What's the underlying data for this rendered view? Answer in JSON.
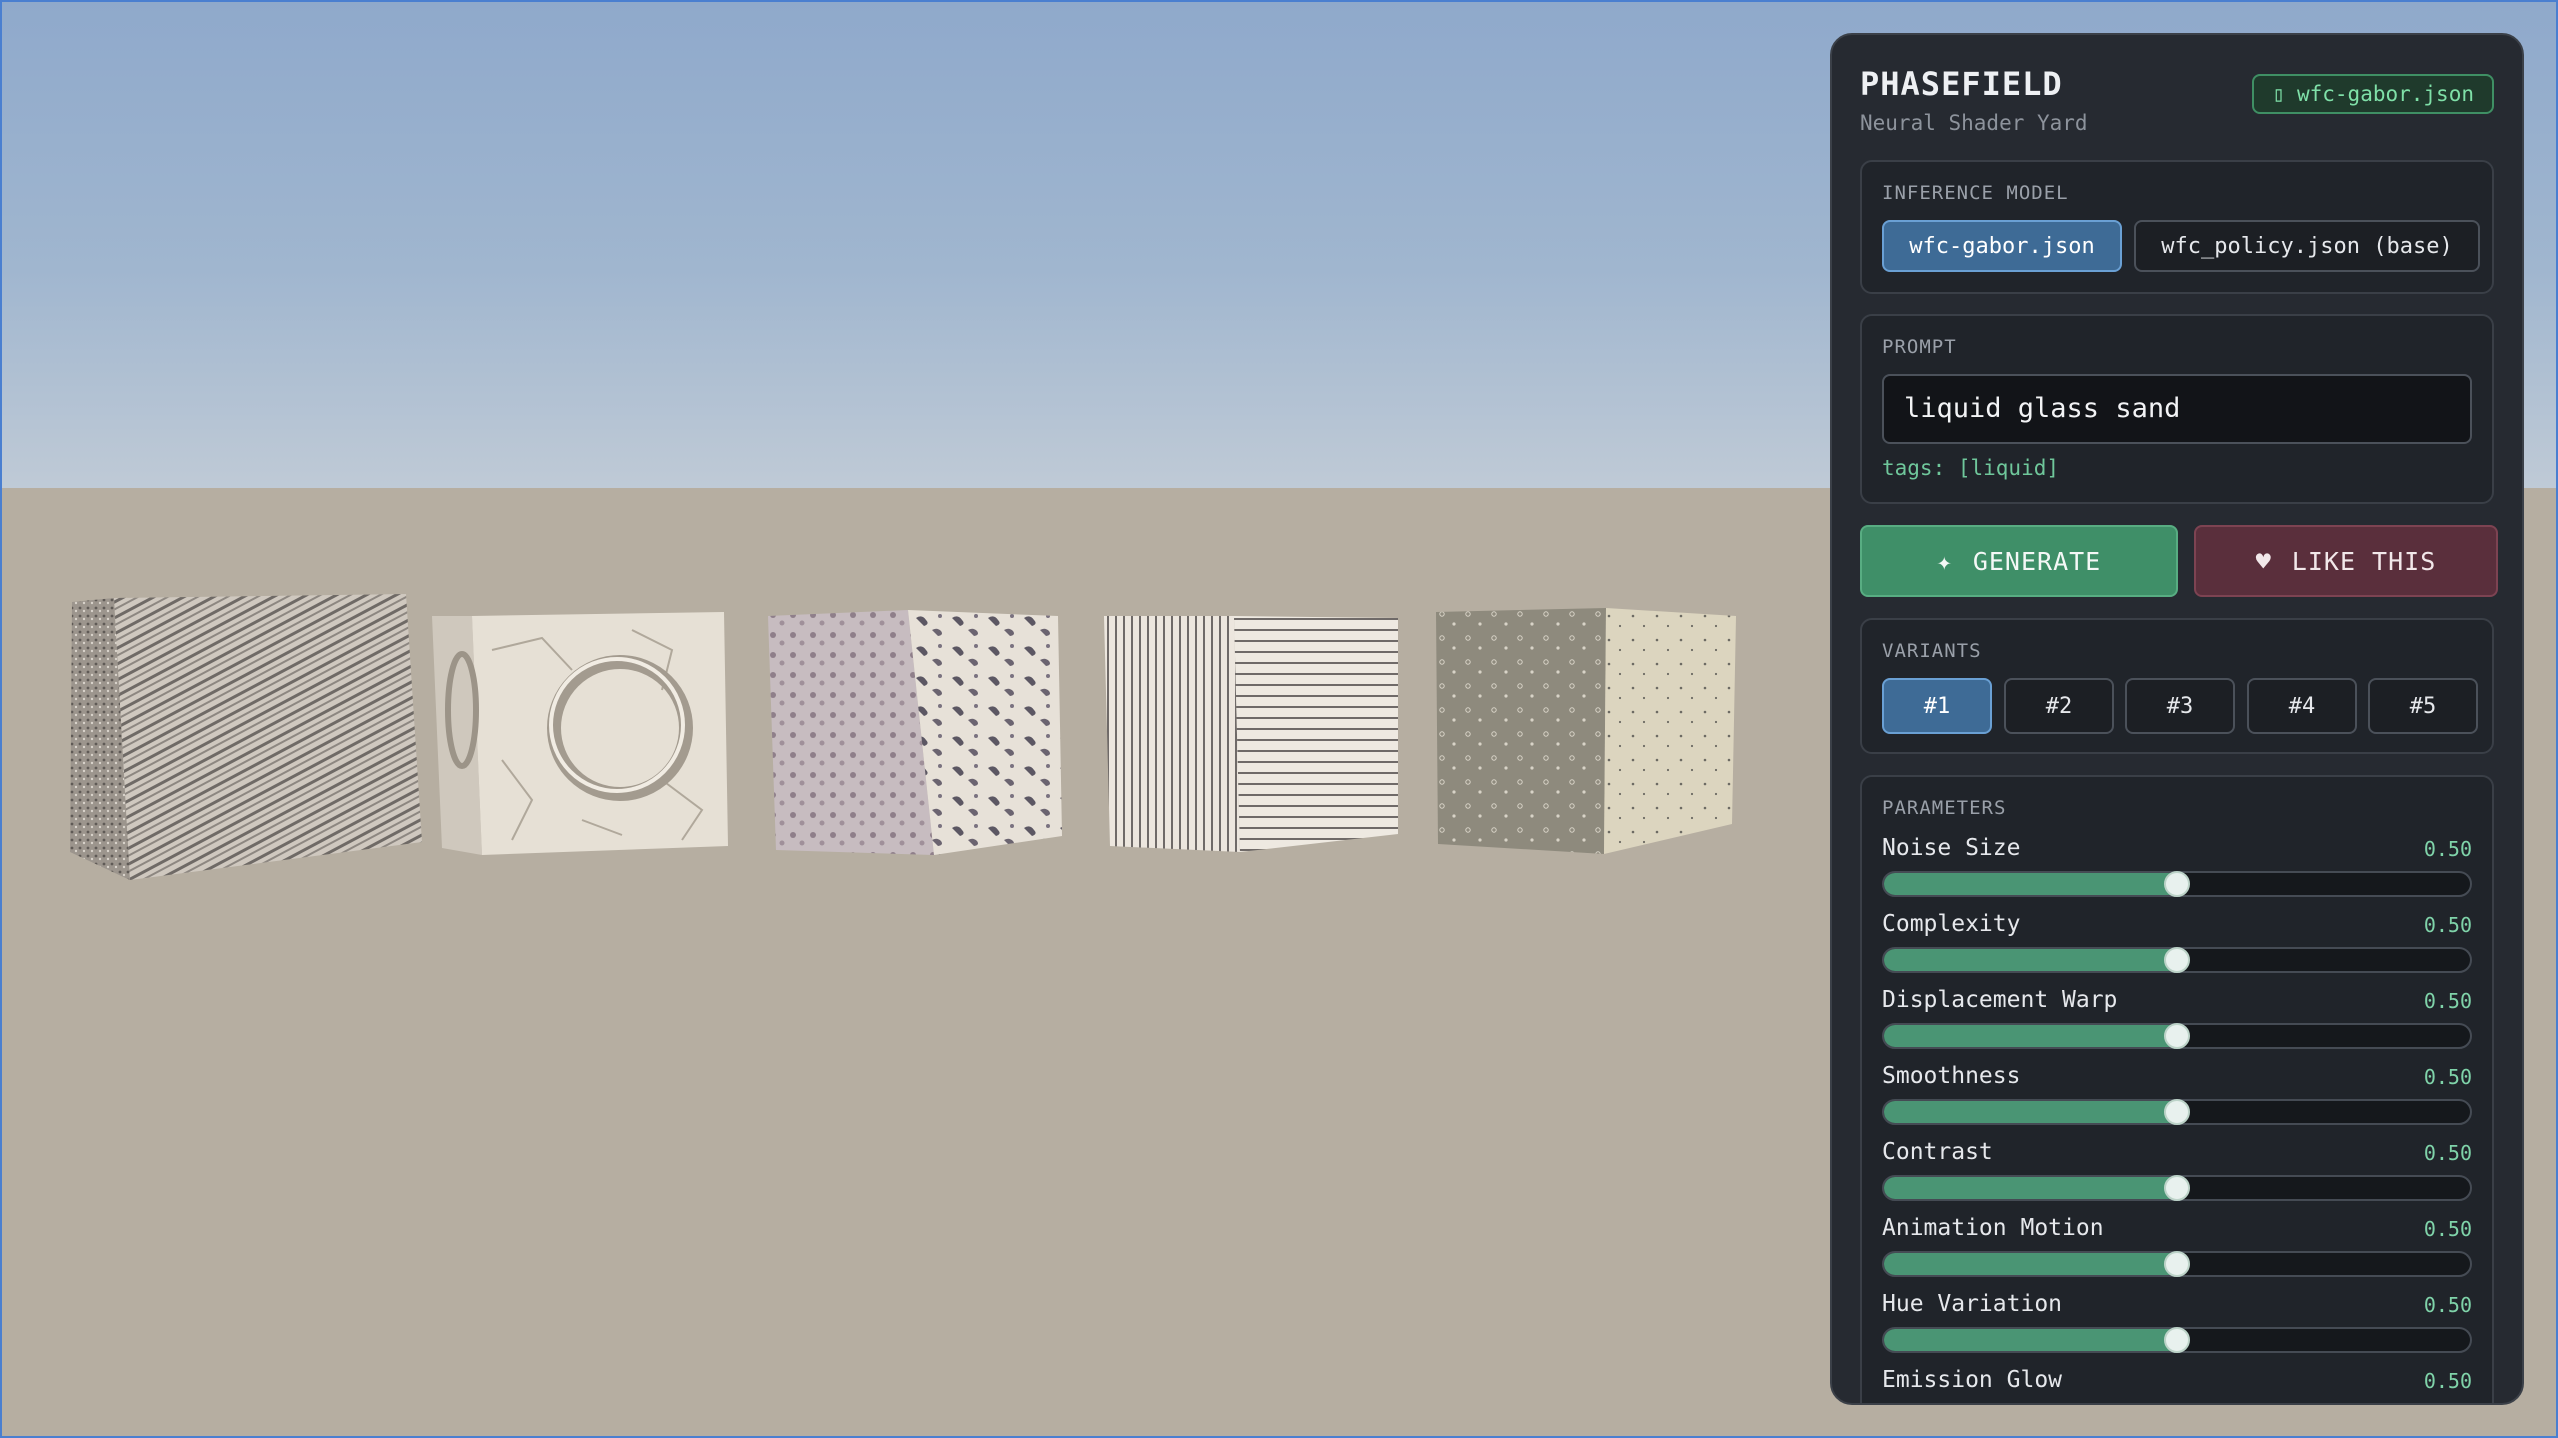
{
  "app": {
    "title": "PHASEFIELD",
    "subtitle": "Neural Shader Yard",
    "badge_icon": "file-icon",
    "badge_label": "wfc-gabor.json"
  },
  "inference": {
    "label": "INFERENCE MODEL",
    "models": [
      {
        "label": "wfc-gabor.json",
        "active": true
      },
      {
        "label": "wfc_policy.json (base)",
        "active": false
      }
    ]
  },
  "prompt": {
    "label": "PROMPT",
    "value": "liquid glass sand",
    "tags": "tags: [liquid]"
  },
  "actions": {
    "generate_icon": "sparkle-icon",
    "generate_label": "GENERATE",
    "like_icon": "heart-icon",
    "like_label": "LIKE THIS"
  },
  "variants": {
    "label": "VARIANTS",
    "items": [
      {
        "label": "#1",
        "active": true
      },
      {
        "label": "#2",
        "active": false
      },
      {
        "label": "#3",
        "active": false
      },
      {
        "label": "#4",
        "active": false
      },
      {
        "label": "#5",
        "active": false
      }
    ]
  },
  "parameters": {
    "label": "PARAMETERS",
    "items": [
      {
        "name": "Noise Size",
        "value": "0.50",
        "level": 0.5
      },
      {
        "name": "Complexity",
        "value": "0.50",
        "level": 0.5
      },
      {
        "name": "Displacement Warp",
        "value": "0.50",
        "level": 0.5
      },
      {
        "name": "Smoothness",
        "value": "0.50",
        "level": 0.5
      },
      {
        "name": "Contrast",
        "value": "0.50",
        "level": 0.5
      },
      {
        "name": "Animation Motion",
        "value": "0.50",
        "level": 0.5
      },
      {
        "name": "Hue Variation",
        "value": "0.50",
        "level": 0.5
      },
      {
        "name": "Emission Glow",
        "value": "0.50",
        "level": 0.5
      }
    ]
  },
  "scene": {
    "cube_count": 5,
    "sky_color": "#9fb5cf",
    "ground_color": "#b6aea1",
    "accent_green": "#3f8f68",
    "accent_blue": "#3e6b96"
  }
}
